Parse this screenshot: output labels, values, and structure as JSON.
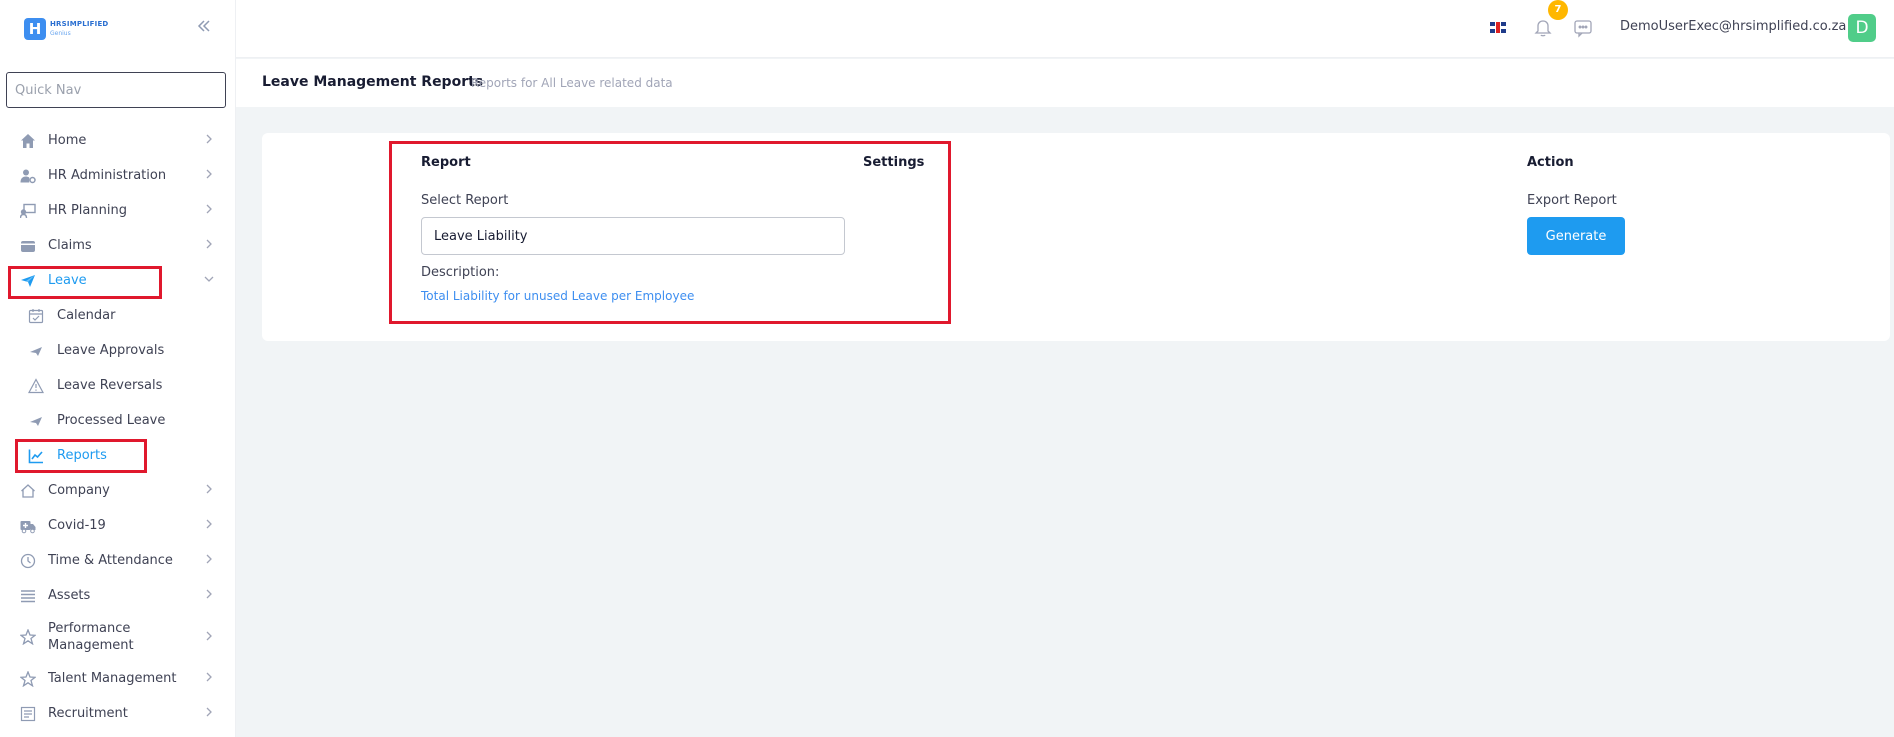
{
  "logo": {
    "line1": "HRSIMPLIFIED",
    "line2": "Genius",
    "mark": "H"
  },
  "quick_nav": {
    "placeholder": "Quick Nav"
  },
  "nav": {
    "home": "Home",
    "hr_admin": "HR Administration",
    "hr_planning": "HR Planning",
    "claims": "Claims",
    "leave": "Leave",
    "leave_sub": {
      "calendar": "Calendar",
      "approvals": "Leave Approvals",
      "reversals": "Leave Reversals",
      "processed": "Processed Leave",
      "reports": "Reports"
    },
    "company": "Company",
    "covid": "Covid-19",
    "time": "Time & Attendance",
    "assets": "Assets",
    "performance": "Performance Management",
    "talent": "Talent Management",
    "recruitment": "Recruitment"
  },
  "topbar": {
    "notification_count": "7",
    "user_email": "DemoUserExec@hrsimplified.co.za",
    "avatar_letter": "D"
  },
  "header": {
    "title": "Leave Management Reports",
    "subtitle": "Reports for All Leave related data"
  },
  "report": {
    "col_report": "Report",
    "col_settings": "Settings",
    "col_action": "Action",
    "select_label": "Select Report",
    "selected_report": "Leave Liability",
    "description_label": "Description:",
    "description": "Total Liability for unused Leave per Employee",
    "export_label": "Export Report",
    "generate_label": "Generate"
  },
  "colors": {
    "accent": "#1e9bf0",
    "highlight": "#e0182d",
    "badge": "#ffb700",
    "avatar": "#50cd89"
  }
}
